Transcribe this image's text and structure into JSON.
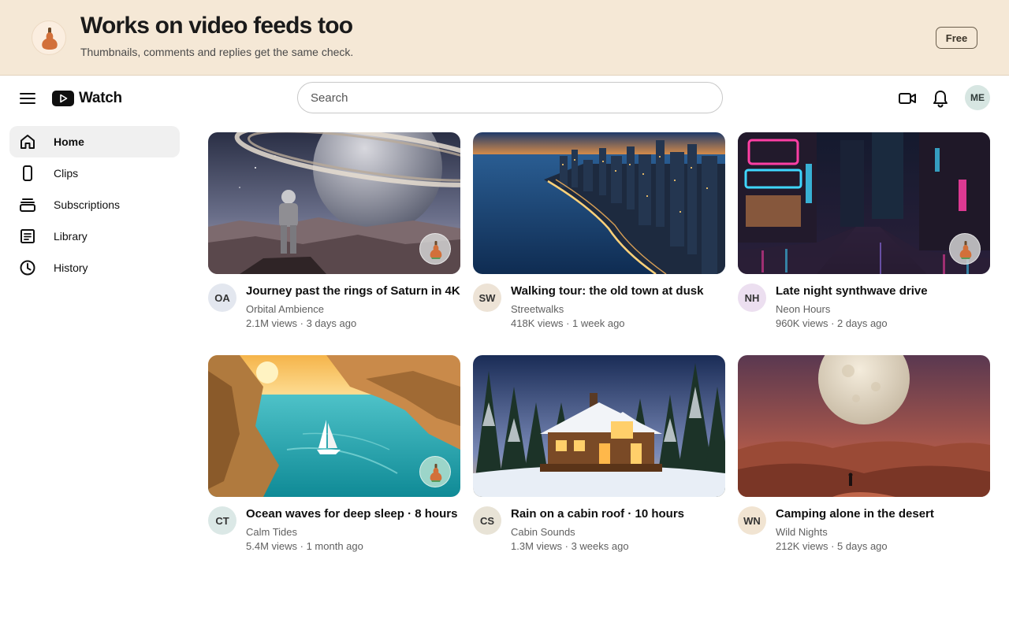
{
  "banner": {
    "title": "Works on video feeds too",
    "subtitle": "Thumbnails, comments and replies get the same check.",
    "cta_label": "Free",
    "logo_icon": "gourd-logo-icon"
  },
  "topbar": {
    "brand_name": "Watch",
    "search_placeholder": "Search",
    "user_initials": "ME",
    "icons": [
      "menu-icon",
      "play-logo-icon",
      "video-camera-icon",
      "bell-icon"
    ]
  },
  "sidebar": {
    "items": [
      {
        "label": "Home",
        "icon": "home-icon",
        "active": true
      },
      {
        "label": "Clips",
        "icon": "phone-icon",
        "active": false
      },
      {
        "label": "Subscriptions",
        "icon": "subscriptions-icon",
        "active": false
      },
      {
        "label": "Library",
        "icon": "library-icon",
        "active": false
      },
      {
        "label": "History",
        "icon": "clock-icon",
        "active": false
      }
    ]
  },
  "videos": [
    {
      "title": "Journey past the rings of Saturn in 4K",
      "channel": "Orbital Ambience",
      "stats": "2.1M views · 3 days ago",
      "initials": "OA",
      "avatar_color": "#e3e7ef",
      "badge": true
    },
    {
      "title": "Walking tour: the old town at dusk",
      "channel": "Streetwalks",
      "stats": "418K views · 1 week ago",
      "initials": "SW",
      "avatar_color": "#ede3d6",
      "badge": false
    },
    {
      "title": "Late night synthwave drive",
      "channel": "Neon Hours",
      "stats": "960K views · 2 days ago",
      "initials": "NH",
      "avatar_color": "#ecdff0",
      "badge": true
    },
    {
      "title": "Ocean waves for deep sleep · 8 hours",
      "channel": "Calm Tides",
      "stats": "5.4M views · 1 month ago",
      "initials": "CT",
      "avatar_color": "#dbe8e6",
      "badge": true
    },
    {
      "title": "Rain on a cabin roof · 10 hours",
      "channel": "Cabin Sounds",
      "stats": "1.3M views · 3 weeks ago",
      "initials": "CS",
      "avatar_color": "#e8e3d6",
      "badge": false
    },
    {
      "title": "Camping alone in the desert",
      "channel": "Wild Nights",
      "stats": "212K views · 5 days ago",
      "initials": "WN",
      "avatar_color": "#f1e4d2",
      "badge": false
    }
  ]
}
